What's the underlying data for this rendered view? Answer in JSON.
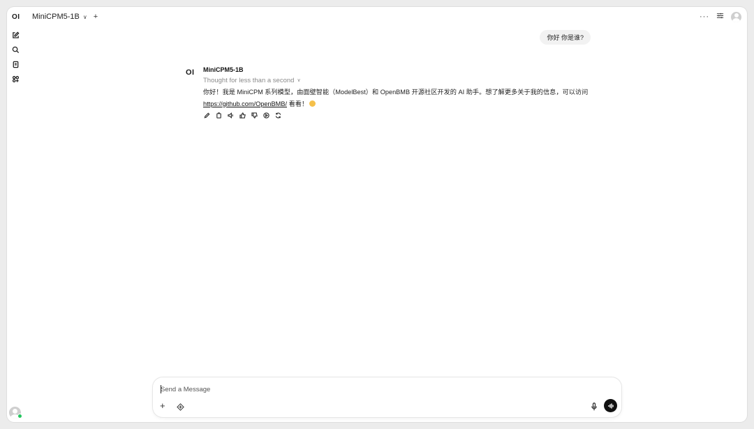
{
  "sidebar": {
    "logo": "OI",
    "items": [
      {
        "name": "new-chat",
        "icon": "pencil-square-icon"
      },
      {
        "name": "search",
        "icon": "search-icon"
      },
      {
        "name": "notes",
        "icon": "notes-icon"
      },
      {
        "name": "workspace",
        "icon": "grid-icon"
      }
    ]
  },
  "header": {
    "model_name": "MiniCPM5-1B",
    "more_label": "···"
  },
  "chat": {
    "user_message": "你好 你是谁?",
    "assistant_logo": "OI",
    "assistant_name": "MiniCPM5-1B",
    "thought_label": "Thought for less than a second",
    "reply_part1": "你好！我是 MiniCPM 系列模型，由面壁智能（ModelBest）和 OpenBMB 开源社区开发的 AI 助手。想了解更多关于我的信息，可以访问 ",
    "reply_link": "https://github.com/OpenBMB/",
    "reply_part2": " 看看！"
  },
  "input": {
    "placeholder": "Send a Message"
  },
  "colors": {
    "accent": "#111111",
    "online": "#22c55e",
    "bubble": "#f2f2f2"
  }
}
